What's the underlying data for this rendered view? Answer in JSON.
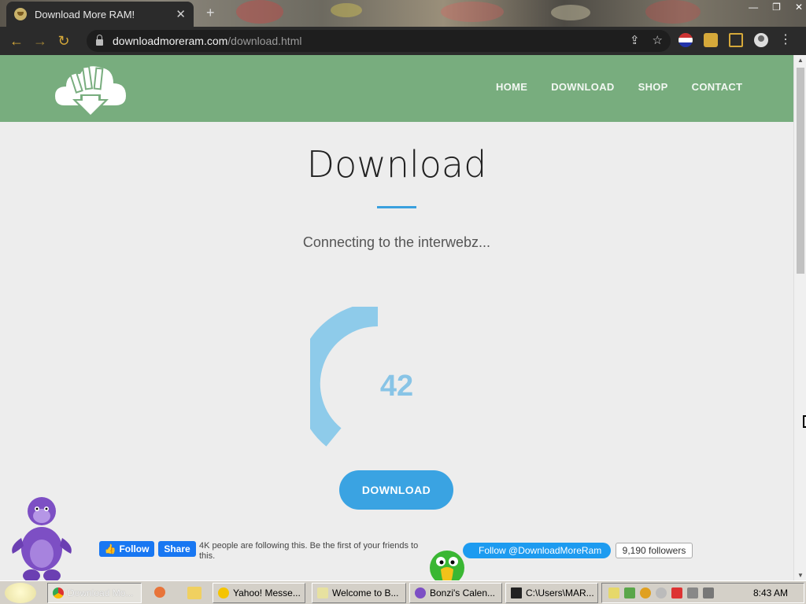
{
  "browser": {
    "tab_title": "Download More RAM!",
    "url_host": "downloadmoreram.com",
    "url_path": "/download.html",
    "new_tab": "+",
    "tab_close": "✕"
  },
  "site": {
    "nav": [
      "HOME",
      "DOWNLOAD",
      "SHOP",
      "CONTACT"
    ],
    "title": "Download",
    "status": "Connecting to the interwebz...",
    "progress_value": "42",
    "download_label": "DOWNLOAD",
    "accent_color": "#3aa3e2",
    "header_color": "#78ad7e"
  },
  "social": {
    "fb_follow": "Follow",
    "fb_share": "Share",
    "fb_text": "4K people are following this. Be the first of your friends to",
    "fb_text_2": "this.",
    "tw_follow": "Follow @DownloadMoreRam",
    "tw_count": "9,190 followers"
  },
  "taskbar": {
    "buttons": [
      "Download Mo...",
      "Yahoo! Messe...",
      "Welcome to B...",
      "Bonzi's Calen...",
      "C:\\Users\\MAR..."
    ],
    "clock": "8:43 AM"
  }
}
